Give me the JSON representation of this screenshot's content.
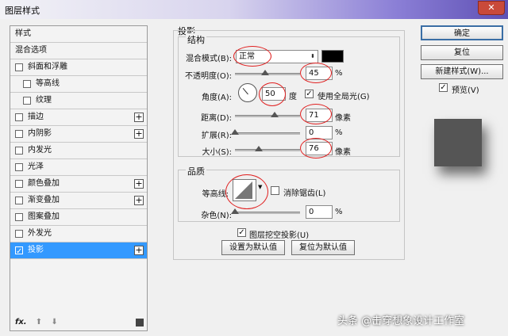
{
  "window": {
    "title": "图层样式",
    "close": "✕"
  },
  "sidebar": {
    "items": [
      {
        "label": "样式",
        "checkbox": false,
        "plus": false,
        "selected": false,
        "indent": 0
      },
      {
        "label": "混合选项",
        "checkbox": false,
        "plus": false,
        "selected": false,
        "indent": 0
      },
      {
        "label": "斜面和浮雕",
        "checkbox": true,
        "plus": false,
        "selected": false,
        "indent": 0
      },
      {
        "label": "等高线",
        "checkbox": true,
        "plus": false,
        "selected": false,
        "indent": 1
      },
      {
        "label": "纹理",
        "checkbox": true,
        "plus": false,
        "selected": false,
        "indent": 1
      },
      {
        "label": "描边",
        "checkbox": true,
        "plus": true,
        "selected": false,
        "indent": 0
      },
      {
        "label": "内阴影",
        "checkbox": true,
        "plus": true,
        "selected": false,
        "indent": 0
      },
      {
        "label": "内发光",
        "checkbox": true,
        "plus": false,
        "selected": false,
        "indent": 0
      },
      {
        "label": "光泽",
        "checkbox": true,
        "plus": false,
        "selected": false,
        "indent": 0
      },
      {
        "label": "颜色叠加",
        "checkbox": true,
        "plus": true,
        "selected": false,
        "indent": 0
      },
      {
        "label": "渐变叠加",
        "checkbox": true,
        "plus": true,
        "selected": false,
        "indent": 0
      },
      {
        "label": "图案叠加",
        "checkbox": true,
        "plus": false,
        "selected": false,
        "indent": 0
      },
      {
        "label": "外发光",
        "checkbox": true,
        "plus": false,
        "selected": false,
        "indent": 0
      },
      {
        "label": "投影",
        "checkbox": true,
        "plus": true,
        "selected": true,
        "checked": true,
        "indent": 0
      }
    ],
    "footer": {
      "fx": "fx.",
      "up": "⬆",
      "down": "⬇"
    }
  },
  "drop_shadow": {
    "title": "投影",
    "structure": {
      "title": "结构",
      "blend_mode_label": "混合模式(B):",
      "blend_mode": "正常",
      "opacity_label": "不透明度(O):",
      "opacity": "45",
      "opacity_unit": "%",
      "angle_label": "角度(A):",
      "angle": "50",
      "angle_unit": "度",
      "global_light_label": "使用全局光(G)",
      "global_light": true,
      "distance_label": "距离(D):",
      "distance": "71",
      "distance_unit": "像素",
      "spread_label": "扩展(R):",
      "spread": "0",
      "spread_unit": "%",
      "size_label": "大小(S):",
      "size": "76",
      "size_unit": "像素"
    },
    "quality": {
      "title": "品质",
      "contour_label": "等高线:",
      "antialias_label": "消除锯齿(L)",
      "antialias": false,
      "noise_label": "杂色(N):",
      "noise": "0",
      "noise_unit": "%"
    },
    "knockout_label": "图层挖空投影(U)",
    "knockout": true,
    "make_default": "设置为默认值",
    "reset_default": "复位为默认值"
  },
  "actions": {
    "ok": "确定",
    "reset": "复位",
    "new_style": "新建样式(W)...",
    "preview_label": "预览(V)",
    "preview": true
  },
  "watermark": "头条 @击穿想象设计工作室",
  "colors": {
    "accent": "#3399ff",
    "annotation": "#e02020",
    "shadow_color": "#000000",
    "preview_fill": "#555555"
  }
}
